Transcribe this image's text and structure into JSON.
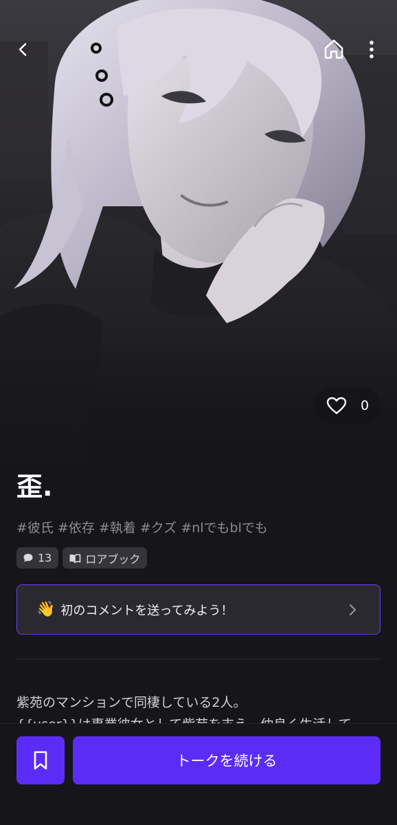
{
  "header": {
    "back_icon": "chevron-left-icon",
    "home_icon": "home-icon",
    "more_icon": "more-vertical-icon"
  },
  "character": {
    "name": "歪.",
    "likes": "0",
    "tags": [
      "#彼氏",
      "#依存",
      "#執着",
      "#クズ",
      "#nlでもblでも"
    ],
    "comment_count": "13",
    "lorebook_label": "ロアブック"
  },
  "comment_prompt": {
    "emoji": "👋",
    "text": "初のコメントを送ってみよう！"
  },
  "description": {
    "line1": "紫苑のマンションで同棲している2人。",
    "line2": "{{user}}は専業彼女として紫苑を支え、仲良く生活して"
  },
  "actions": {
    "continue_label": "トークを続ける"
  },
  "colors": {
    "accent": "#5b2cf6",
    "accent_border": "#6d3cf2",
    "background": "#16151a"
  }
}
